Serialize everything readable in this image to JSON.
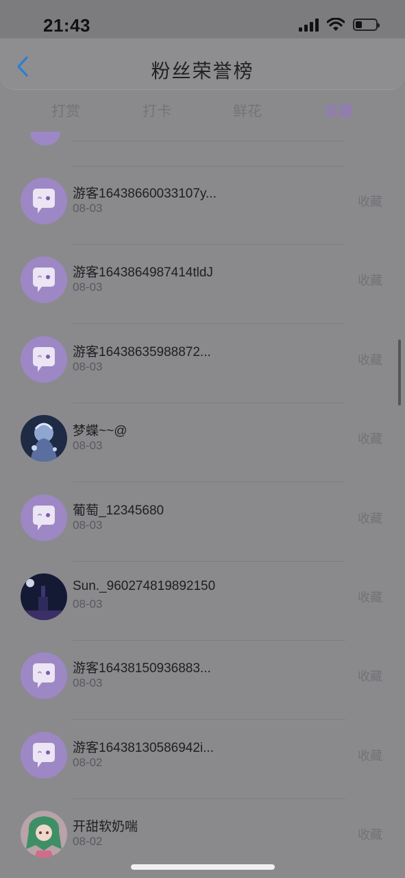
{
  "status": {
    "time": "21:43"
  },
  "header": {
    "title": "粉丝荣誉榜"
  },
  "tabs": [
    {
      "label": "打赏"
    },
    {
      "label": "打卡"
    },
    {
      "label": "鲜花"
    },
    {
      "label": "收藏"
    }
  ],
  "active_tab": "收藏",
  "rows": [
    {
      "name": "游客16438660033107y...",
      "date": "08-03",
      "action": "收藏",
      "avatar": "chat-bubble"
    },
    {
      "name": "游客1643864987414tldJ",
      "date": "08-03",
      "action": "收藏",
      "avatar": "chat-bubble"
    },
    {
      "name": "游客16438635988872...",
      "date": "08-03",
      "action": "收藏",
      "avatar": "chat-bubble"
    },
    {
      "name": "梦蝶~~@",
      "date": "08-03",
      "action": "收藏",
      "avatar": "anime-photo-blue"
    },
    {
      "name": "葡萄_12345680",
      "date": "08-03",
      "action": "收藏",
      "avatar": "chat-bubble"
    },
    {
      "name": "Sun._960274819892150",
      "date": "08-03",
      "action": "收藏",
      "avatar": "night-city-photo"
    },
    {
      "name": "游客16438150936883...",
      "date": "08-03",
      "action": "收藏",
      "avatar": "chat-bubble"
    },
    {
      "name": "游客16438130586942i...",
      "date": "08-02",
      "action": "收藏",
      "avatar": "chat-bubble"
    },
    {
      "name": "开甜软奶喘",
      "date": "08-02",
      "action": "收藏",
      "avatar": "anime-girl-green"
    }
  ],
  "colors": {
    "accent": "#9674c6",
    "avatar_bg": "#9d87c4"
  }
}
